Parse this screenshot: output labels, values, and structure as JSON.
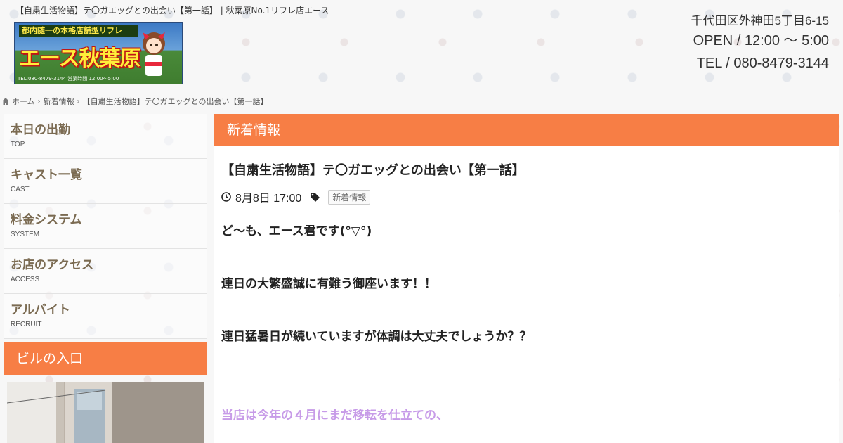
{
  "page_title": "【自粛生活物語】テ〇ガエッグとの出会い【第一話】 | 秋葉原No.1リフレ店エース",
  "logo": {
    "sub": "都内随一の本格店舗型リフレ",
    "main": "エース秋葉原",
    "tel": "TEL:080-8479-3144 営業時間 12:00〜5:00"
  },
  "shop": {
    "address": "千代田区外神田5丁目6-15",
    "open": "OPEN / 12:00 ～ 5:00",
    "tel": "TEL / 080-8479-3144"
  },
  "breadcrumb": {
    "home": "ホーム",
    "news": "新着情報",
    "current": "【自粛生活物語】テ〇ガエッグとの出会い【第一話】"
  },
  "sidebar": {
    "items": [
      {
        "jp": "本日の出勤",
        "en": "TOP"
      },
      {
        "jp": "キャスト一覧",
        "en": "CAST"
      },
      {
        "jp": "料金システム",
        "en": "SYSTEM"
      },
      {
        "jp": "お店のアクセス",
        "en": "ACCESS"
      },
      {
        "jp": "アルバイト",
        "en": "RECRUIT"
      }
    ],
    "widget_title": "ビルの入口"
  },
  "main": {
    "header": "新着情報",
    "post_title": "【自粛生活物語】テ〇ガエッグとの出会い【第一話】",
    "date": "8月8日 17:00",
    "tag": "新着情報",
    "lines": [
      "ど〜も、エース君です(°▽°)",
      "連日の大繁盛誠に有難う御座います！！",
      "連日猛暑日が続いていますが体調は大丈夫でしょうか？？",
      "当店は今年の４月にまだ移転を仕立ての、"
    ]
  },
  "colors": {
    "accent": "#f77e45",
    "nav_text": "#7b6b52",
    "highlight_text": "#c79be8"
  }
}
